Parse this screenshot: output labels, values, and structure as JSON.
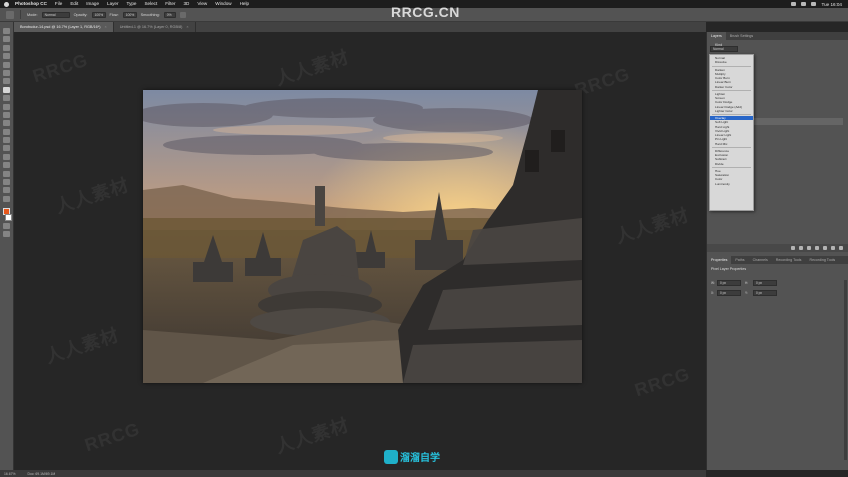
{
  "menubar": {
    "items": [
      "Photoshop CC",
      "File",
      "Edit",
      "Image",
      "Layer",
      "Type",
      "Select",
      "Filter",
      "3D",
      "View",
      "Window",
      "Help"
    ],
    "clock": "Tue 16:04"
  },
  "optionsbar": {
    "mode_label": "Mode:",
    "mode_value": "Normal",
    "opacity_label": "Opacity:",
    "opacity_value": "100%",
    "flow_label": "Flow:",
    "flow_value": "100%",
    "smoothing_label": "Smoothing:",
    "smoothing_value": "0%"
  },
  "document_tabs": [
    {
      "label": "Borobudur-14.psd @ 16.7% (Layer 1, RGB/16*)",
      "active": true
    },
    {
      "label": "Untitled-1 @ 16.7% (Layer 0, RGB/8)",
      "active": false
    }
  ],
  "status_bar": {
    "zoom": "16.67%",
    "doc_size": "Doc: 69.1M/69.1M"
  },
  "right_panel": {
    "layers_tabs": [
      "Layers",
      "Brush Settings"
    ],
    "filter_kind": "Kind",
    "properties_tabs": [
      "Properties",
      "Paths",
      "Channels",
      "Recording Tools",
      "Recording Tools"
    ],
    "properties_title": "Pixel Layer Properties",
    "prop_w_label": "W:",
    "prop_w_value": "0 px",
    "prop_h_label": "H:",
    "prop_h_value": "0 px",
    "prop_x_label": "X:",
    "prop_x_value": "0 px",
    "prop_y_label": "Y:",
    "prop_y_value": "0 px"
  },
  "blend_dropdown": {
    "current": "Normal",
    "groups": [
      [
        "Normal",
        "Dissolve"
      ],
      [
        "Darken",
        "Multiply",
        "Color Burn",
        "Linear Burn",
        "Darker Color"
      ],
      [
        "Lighten",
        "Screen",
        "Color Dodge",
        "Linear Dodge (Add)",
        "Lighter Color"
      ],
      [
        "Overlay",
        "Soft Light",
        "Hard Light",
        "Vivid Light",
        "Linear Light",
        "Pin Light",
        "Hard Mix"
      ],
      [
        "Difference",
        "Exclusion",
        "Subtract",
        "Divide"
      ],
      [
        "Hue",
        "Saturation",
        "Color",
        "Luminosity"
      ]
    ],
    "selected": "Overlay"
  },
  "overlays": {
    "site_watermark": "RRCG.CN",
    "tiled_watermark": "RRCG",
    "tiled_watermark_cn": "人人素材",
    "logo_text": "溜溜自学"
  },
  "colors": {
    "foreground_swatch": "#e8571b",
    "background_swatch": "#ffffff",
    "selection_blue": "#2866c8"
  }
}
